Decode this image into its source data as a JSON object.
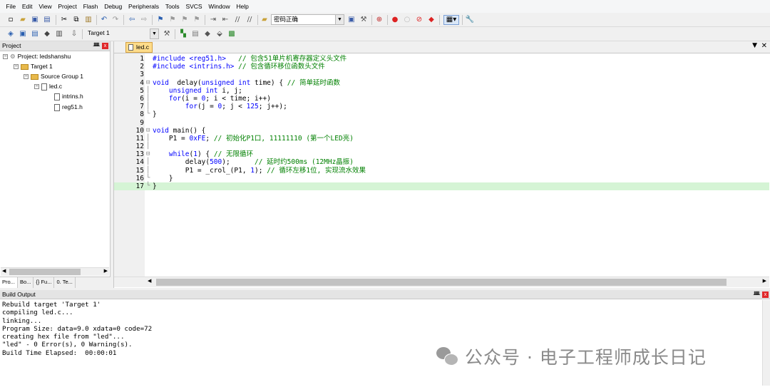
{
  "menu": [
    "File",
    "Edit",
    "View",
    "Project",
    "Flash",
    "Debug",
    "Peripherals",
    "Tools",
    "SVCS",
    "Window",
    "Help"
  ],
  "toolbar": {
    "search_combo": "密码正确",
    "target_combo": "Target 1"
  },
  "project_panel": {
    "title": "Project",
    "tree": [
      {
        "label": "Project: ledshanshu",
        "level": 0
      },
      {
        "label": "Target 1",
        "level": 1
      },
      {
        "label": "Source Group 1",
        "level": 2
      },
      {
        "label": "led.c",
        "level": 3
      },
      {
        "label": "intrins.h",
        "level": 4
      },
      {
        "label": "reg51.h",
        "level": 4
      }
    ],
    "tabs": [
      "Pro...",
      "Bo...",
      "{} Fu...",
      "0. Te..."
    ]
  },
  "editor": {
    "tab": "led.c",
    "active_line": 17,
    "lines": [
      {
        "n": "1",
        "fold": "",
        "segs": [
          [
            "pp",
            "#include <reg51.h>   "
          ],
          [
            "cm",
            "// 包含51单片机寄存器定义头文件"
          ]
        ]
      },
      {
        "n": "2",
        "fold": "",
        "segs": [
          [
            "pp",
            "#include <intrins.h> "
          ],
          [
            "cm",
            "// 包含循环移位函数头文件"
          ]
        ]
      },
      {
        "n": "3",
        "fold": "",
        "segs": []
      },
      {
        "n": "4",
        "fold": "⊟",
        "segs": [
          [
            "kw",
            "void"
          ],
          [
            "",
            "  delay("
          ],
          [
            "kw",
            "unsigned int"
          ],
          [
            "",
            " time) { "
          ],
          [
            "cm",
            "// 简单延时函数"
          ]
        ]
      },
      {
        "n": "5",
        "fold": "│",
        "segs": [
          [
            "",
            "    "
          ],
          [
            "kw",
            "unsigned int"
          ],
          [
            "",
            " i, j;"
          ]
        ]
      },
      {
        "n": "6",
        "fold": "│",
        "segs": [
          [
            "",
            "    "
          ],
          [
            "kw",
            "for"
          ],
          [
            "",
            "(i = "
          ],
          [
            "num",
            "0"
          ],
          [
            "",
            "; i < time; i++)"
          ]
        ]
      },
      {
        "n": "7",
        "fold": "│",
        "segs": [
          [
            "",
            "        "
          ],
          [
            "kw",
            "for"
          ],
          [
            "",
            "(j = "
          ],
          [
            "num",
            "0"
          ],
          [
            "",
            "; j < "
          ],
          [
            "num",
            "125"
          ],
          [
            "",
            "; j++);"
          ]
        ]
      },
      {
        "n": "8",
        "fold": "└",
        "segs": [
          [
            "",
            "}"
          ]
        ]
      },
      {
        "n": "9",
        "fold": "",
        "segs": []
      },
      {
        "n": "10",
        "fold": "⊟",
        "segs": [
          [
            "kw",
            "void"
          ],
          [
            "",
            " main() {"
          ]
        ]
      },
      {
        "n": "11",
        "fold": "│",
        "segs": [
          [
            "",
            "    P1 = "
          ],
          [
            "num",
            "0xFE"
          ],
          [
            "",
            "; "
          ],
          [
            "cm",
            "// 初始化P1口, 11111110 (第一个LED亮)"
          ]
        ]
      },
      {
        "n": "12",
        "fold": "│",
        "segs": []
      },
      {
        "n": "13",
        "fold": "⊟",
        "segs": [
          [
            "",
            "    "
          ],
          [
            "kw",
            "while"
          ],
          [
            "",
            "("
          ],
          [
            "num",
            "1"
          ],
          [
            "",
            ") { "
          ],
          [
            "cm",
            "// 无限循环"
          ]
        ]
      },
      {
        "n": "14",
        "fold": "│",
        "segs": [
          [
            "",
            "        delay("
          ],
          [
            "num",
            "500"
          ],
          [
            "",
            "); "
          ],
          [
            "cm",
            "     // 延时约500ms (12MHz晶振)"
          ]
        ]
      },
      {
        "n": "15",
        "fold": "│",
        "segs": [
          [
            "",
            "        P1 = _crol_(P1, "
          ],
          [
            "num",
            "1"
          ],
          [
            "",
            "); "
          ],
          [
            "cm",
            "// 循环左移1位, 实现流水效果"
          ]
        ]
      },
      {
        "n": "16",
        "fold": "└",
        "segs": [
          [
            "",
            "    }"
          ]
        ]
      },
      {
        "n": "17",
        "fold": "└",
        "segs": [
          [
            "",
            "}"
          ]
        ]
      }
    ]
  },
  "build_output": {
    "title": "Build Output",
    "lines": [
      "Rebuild target 'Target 1'",
      "compiling led.c...",
      "linking...",
      "Program Size: data=9.0 xdata=0 code=72",
      "creating hex file from \"led\"...",
      "\"led\" - 0 Error(s), 0 Warning(s).",
      "Build Time Elapsed:  00:00:01"
    ]
  },
  "watermark": "公众号 · 电子工程师成长日记"
}
